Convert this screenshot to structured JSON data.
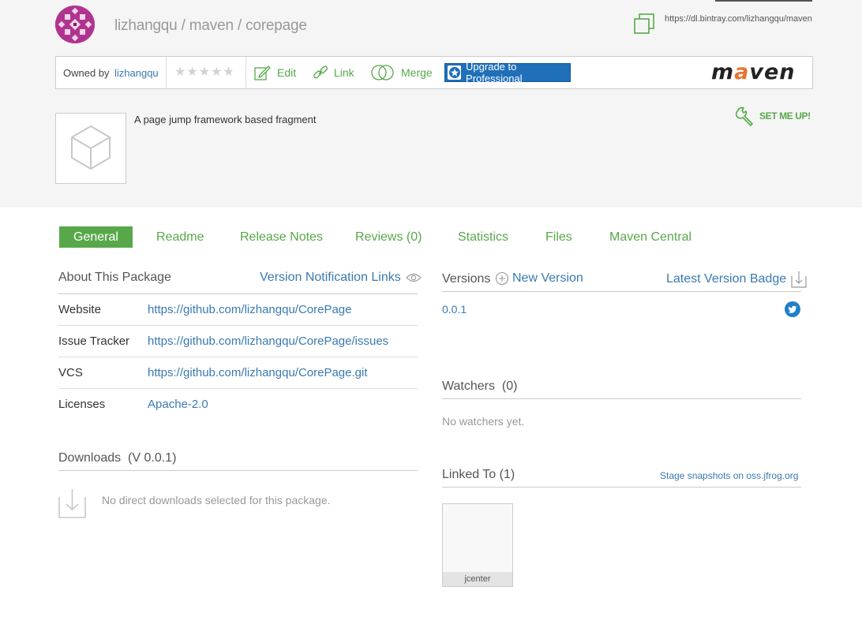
{
  "header": {
    "breadcrumb": [
      "lizhangqu",
      "maven",
      "corepage"
    ],
    "separator": " / ",
    "repo_url": "https://dl.bintray.com/lizhangqu/maven"
  },
  "toolbar": {
    "owned_by_label": "Owned by",
    "owner": "lizhangqu",
    "rating_stars": 5,
    "rating_value": 0,
    "edit_label": "Edit",
    "link_label": "Link",
    "merge_label": "Merge",
    "upgrade_label": "Upgrade to Professional",
    "logo_text_pre": "m",
    "logo_text_accent": "a",
    "logo_text_post": "ven"
  },
  "set_me_up": "SET ME UP!",
  "package": {
    "description": "A page jump framework based fragment"
  },
  "tabs": [
    {
      "label": "General",
      "active": true
    },
    {
      "label": "Readme"
    },
    {
      "label": "Release Notes"
    },
    {
      "label": "Reviews (0)"
    },
    {
      "label": "Statistics"
    },
    {
      "label": "Files"
    },
    {
      "label": "Maven Central"
    }
  ],
  "about": {
    "title": "About This Package",
    "notification_links": "Version Notification Links",
    "rows": [
      {
        "key": "Website",
        "value": "https://github.com/lizhangqu/CorePage"
      },
      {
        "key": "Issue Tracker",
        "value": "https://github.com/lizhangqu/CorePage/issues"
      },
      {
        "key": "VCS",
        "value": "https://github.com/lizhangqu/CorePage.git"
      },
      {
        "key": "Licenses",
        "value": "Apache-2.0"
      }
    ]
  },
  "downloads": {
    "title": "Downloads",
    "version": "(V 0.0.1)",
    "empty": "No direct downloads selected for this package."
  },
  "versions": {
    "title": "Versions",
    "new_version": "New Version",
    "latest_badge": "Latest Version Badge",
    "items": [
      "0.0.1"
    ]
  },
  "watchers": {
    "title": "Watchers",
    "count": "(0)",
    "empty": "No watchers yet."
  },
  "linked_to": {
    "title": "Linked To (1)",
    "stage_link": "Stage snapshots on oss.jfrog.org",
    "repos": [
      "jcenter"
    ]
  },
  "colors": {
    "accent_green": "#58a84a",
    "link_blue": "#3a7ab0",
    "upgrade_blue": "#1f6fb9",
    "avatar_magenta": "#b0348f"
  }
}
